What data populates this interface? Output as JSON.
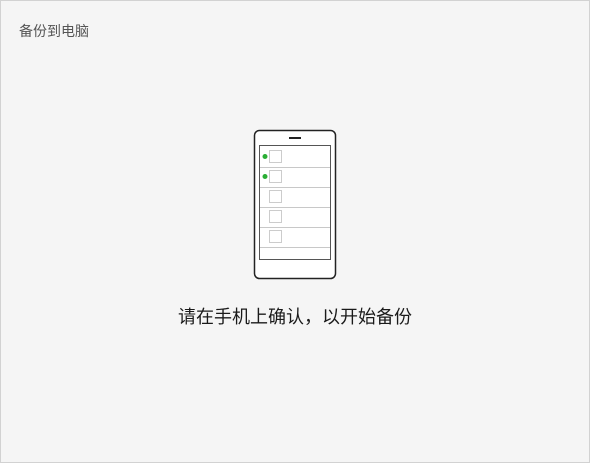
{
  "window": {
    "title": "备份到电脑"
  },
  "illustration": {
    "icon": "phone-confirm-icon",
    "list_rows": [
      {
        "selected": true
      },
      {
        "selected": true
      },
      {
        "selected": false
      },
      {
        "selected": false
      },
      {
        "selected": false
      }
    ],
    "colors": {
      "outline": "#222222",
      "row_line": "#c8c8c8",
      "checkbox": "#cccccc",
      "selected_dot": "#2aae35"
    }
  },
  "prompt": {
    "text": "请在手机上确认，以开始备份"
  }
}
